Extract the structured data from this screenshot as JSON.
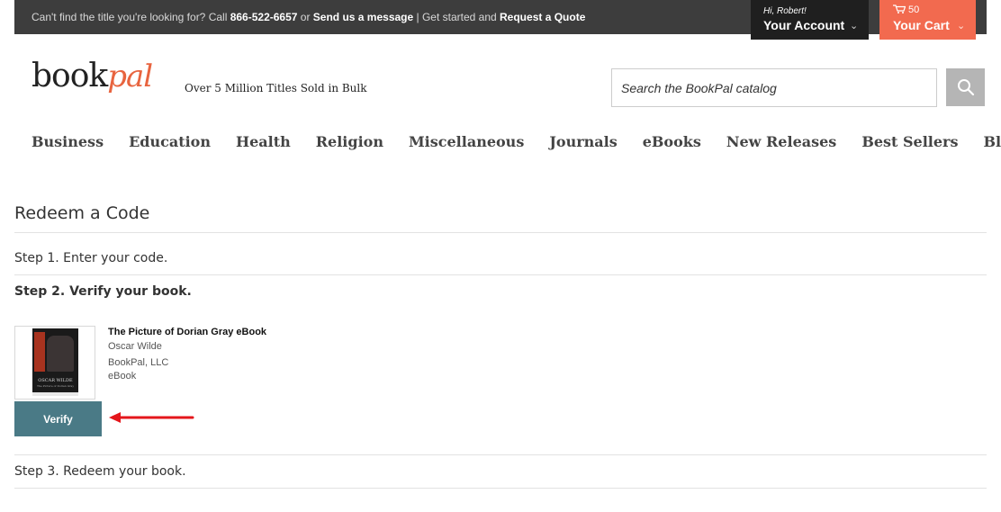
{
  "topbar": {
    "prefix": "Can't find the title you're looking for? Call ",
    "phone": "866-522-6657",
    "or": " or ",
    "message_link": "Send us a message",
    "separator": " | Get started and ",
    "quote_link": "Request a Quote"
  },
  "account": {
    "greeting": "Hi, Robert!",
    "label": "Your Account"
  },
  "cart": {
    "count": "50",
    "label": "Your Cart"
  },
  "logo": {
    "book": "book",
    "pal": "pal"
  },
  "tagline": "Over 5 Million Titles Sold in Bulk",
  "search": {
    "placeholder": "Search the BookPal catalog",
    "value": ""
  },
  "nav": {
    "items": [
      {
        "label": "Business"
      },
      {
        "label": "Education"
      },
      {
        "label": "Health"
      },
      {
        "label": "Religion"
      },
      {
        "label": "Miscellaneous"
      },
      {
        "label": "Journals"
      },
      {
        "label": "eBooks"
      },
      {
        "label": "New Releases"
      },
      {
        "label": "Best Sellers"
      },
      {
        "label": "Blog"
      }
    ]
  },
  "page": {
    "title": "Redeem a Code",
    "step1": "Step 1. Enter your code.",
    "step2": "Step 2. Verify your book.",
    "step3": "Step 3. Redeem your book."
  },
  "book": {
    "title": "The Picture of Dorian Gray eBook",
    "author": "Oscar Wilde",
    "publisher": "BookPal, LLC",
    "format": "eBook",
    "cover_author": "OSCAR WILDE",
    "cover_title": "The Picture of Dorian Gray"
  },
  "verify_button": "Verify",
  "colors": {
    "topbar": "#3d3d3d",
    "account": "#1f1f1f",
    "cart": "#f26a4f",
    "verify": "#4a7a86",
    "arrow": "#e4161b"
  }
}
